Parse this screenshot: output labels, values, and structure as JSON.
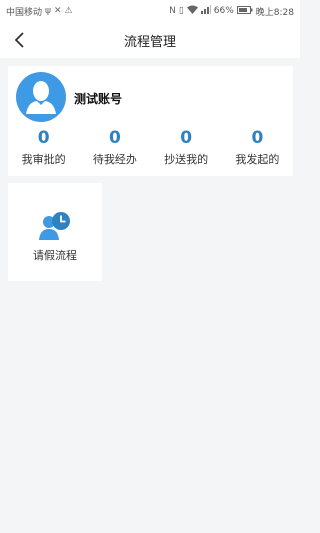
{
  "status_bar": {
    "carrier": "中国移动",
    "battery": "66%",
    "time": "晚上8:28"
  },
  "nav": {
    "title": "流程管理"
  },
  "profile": {
    "name": "测试账号"
  },
  "stats": [
    {
      "value": "0",
      "label": "我审批的"
    },
    {
      "value": "0",
      "label": "待我经办"
    },
    {
      "value": "0",
      "label": "抄送我的"
    },
    {
      "value": "0",
      "label": "我发起的"
    }
  ],
  "apps": [
    {
      "label": "请假流程",
      "icon": "person-clock-icon"
    }
  ],
  "colors": {
    "accent": "#3f9ae6",
    "stat_value": "#2f82c2",
    "background": "#f4f5f7"
  }
}
